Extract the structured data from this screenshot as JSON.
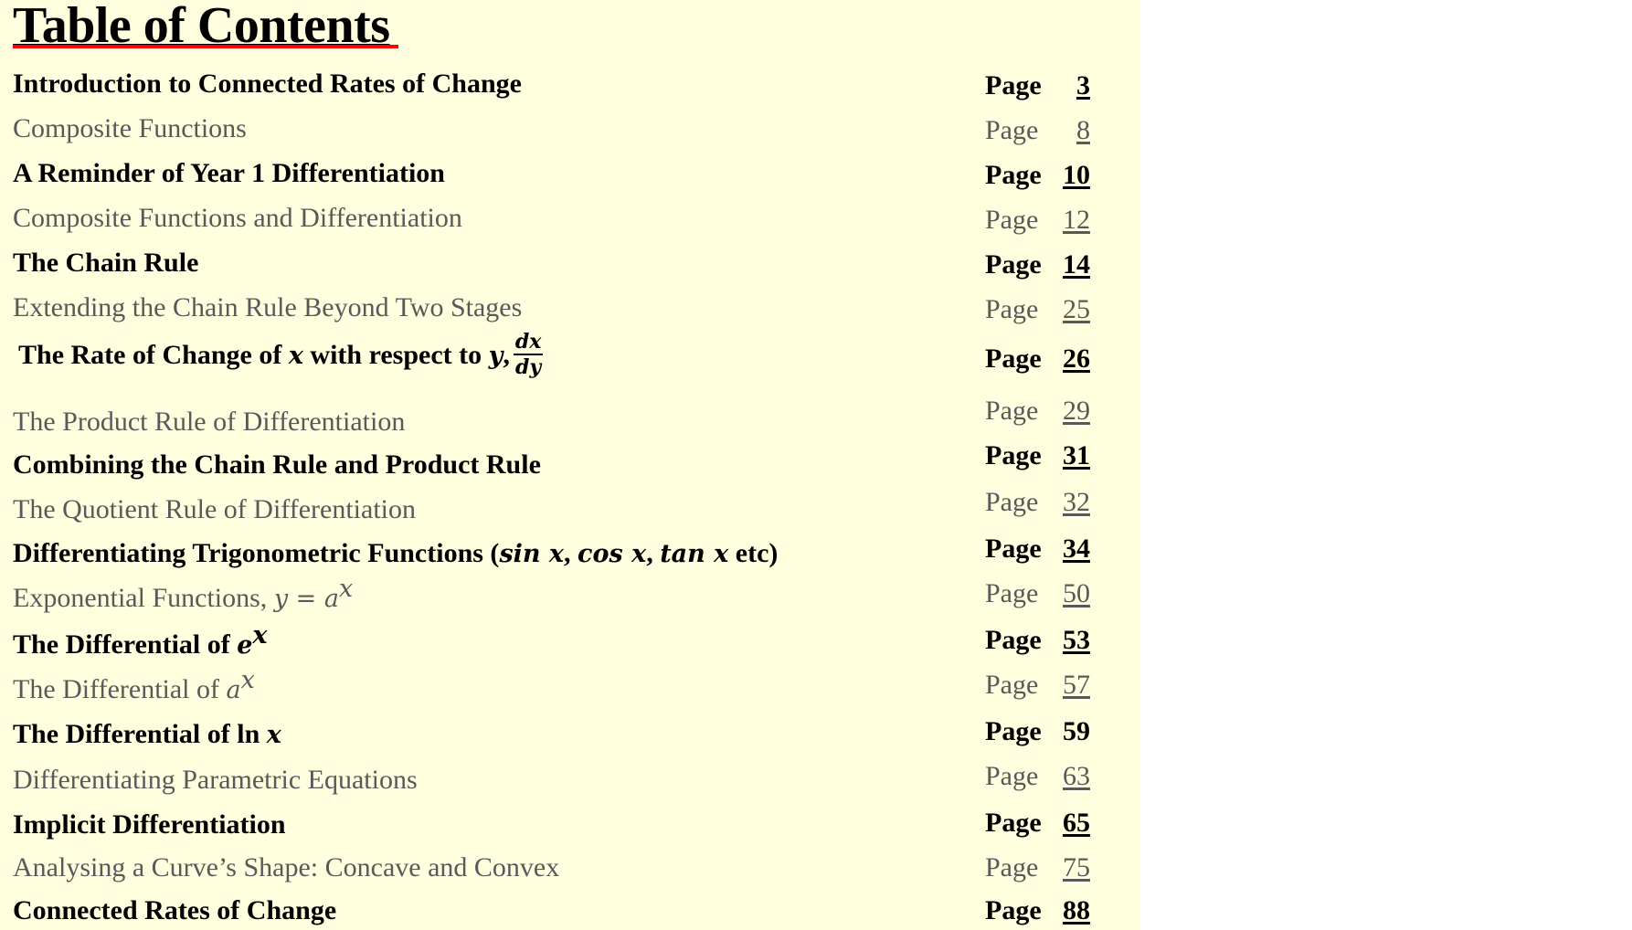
{
  "title": "Table of Contents",
  "colors": {
    "background": "#ffffe0",
    "primary_text": "#000000",
    "secondary_text": "#595959",
    "title_underline": "#ff0000"
  },
  "page_label": "Page",
  "entries": [
    {
      "text": "Introduction to Connected Rates of Change",
      "page": "3",
      "style": "bold",
      "linked": true
    },
    {
      "text": "Composite Functions",
      "page": "8",
      "style": "gray",
      "linked": true
    },
    {
      "text": "A Reminder of Year 1 Differentiation",
      "page": "10",
      "style": "bold",
      "linked": true
    },
    {
      "text": "Composite Functions and Differentiation",
      "page": "12",
      "style": "gray",
      "linked": true
    },
    {
      "text": "The Chain Rule",
      "page": "14",
      "style": "bold",
      "linked": true
    },
    {
      "text": "Extending the Chain Rule Beyond Two Stages",
      "page": "25",
      "style": "gray",
      "linked": true
    },
    {
      "text_parts": {
        "a": "The Rate of Change of ",
        "x": "x",
        "b": " with respect to ",
        "y": "y",
        "comma": ",",
        "frac_num": "dx",
        "frac_den": "dy"
      },
      "text": "The Rate of Change of x with respect to y, dx/dy",
      "page": "26",
      "style": "bold",
      "linked": true
    },
    {
      "text": "The Product Rule of Differentiation",
      "page": "29",
      "style": "gray",
      "linked": true
    },
    {
      "text": "Combining the Chain Rule and Product Rule",
      "page": "31",
      "style": "bold",
      "linked": true
    },
    {
      "text": "The Quotient Rule of Differentiation",
      "page": "32",
      "style": "gray",
      "linked": true
    },
    {
      "text_parts": {
        "a": "Differentiating Trigonometric Functions (",
        "m1": "sin x",
        "c1": ", ",
        "m2": "cos x",
        "c2": ", ",
        "m3": "tan x",
        "b": " etc)"
      },
      "text": "Differentiating Trigonometric Functions (sin x, cos x, tan x etc)",
      "page": "34",
      "style": "bold",
      "linked": true
    },
    {
      "text_parts": {
        "a": "Exponential Functions, ",
        "m": "y = a",
        "sup": "x"
      },
      "text": "Exponential Functions, y = a^x",
      "page": "50",
      "style": "gray",
      "linked": true
    },
    {
      "text_parts": {
        "a": "The Differential of ",
        "m": "e",
        "sup": "x"
      },
      "text": "The Differential of e^x",
      "page": "53",
      "style": "bold",
      "linked": true
    },
    {
      "text_parts": {
        "a": "The Differential of ",
        "m": "a",
        "sup": "x"
      },
      "text": "The Differential of a^x",
      "page": "57",
      "style": "gray",
      "linked": true
    },
    {
      "text_parts": {
        "a": "The Differential of ln ",
        "m": "x"
      },
      "text": "The Differential of ln x",
      "page": "59",
      "style": "bold",
      "linked": false
    },
    {
      "text": "Differentiating Parametric Equations",
      "page": "63",
      "style": "gray",
      "linked": true
    },
    {
      "text": "Implicit Differentiation",
      "page": "65",
      "style": "bold",
      "linked": true
    },
    {
      "text": "Analysing a Curve’s Shape: Concave and Convex",
      "page": "75",
      "style": "gray",
      "linked": true
    },
    {
      "text": "Connected Rates of Change",
      "page": "88",
      "style": "bold",
      "linked": true
    }
  ]
}
